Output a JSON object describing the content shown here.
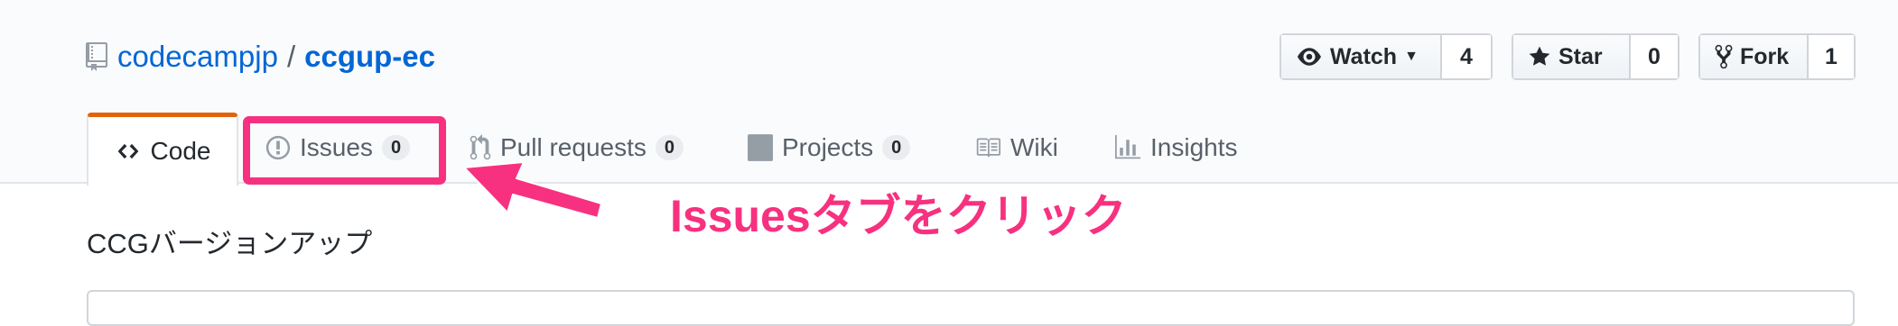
{
  "repo": {
    "owner": "codecampjp",
    "separator": "/",
    "name": "ccgup-ec",
    "description": "CCGバージョンアップ"
  },
  "actions": {
    "watch": {
      "label": "Watch",
      "count": "4",
      "icon": "eye-icon"
    },
    "star": {
      "label": "Star",
      "count": "0",
      "icon": "star-icon"
    },
    "fork": {
      "label": "Fork",
      "count": "1",
      "icon": "repo-forked-icon"
    }
  },
  "tabs": [
    {
      "label": "Code",
      "icon": "code-icon",
      "selected": true
    },
    {
      "label": "Issues",
      "count": "0",
      "icon": "issue-opened-icon"
    },
    {
      "label": "Pull requests",
      "count": "0",
      "icon": "git-pull-request-icon"
    },
    {
      "label": "Projects",
      "count": "0",
      "icon": "project-icon"
    },
    {
      "label": "Wiki",
      "icon": "book-icon"
    },
    {
      "label": "Insights",
      "icon": "graph-icon"
    }
  ],
  "annotation": {
    "text": "Issuesタブをクリック",
    "color": "#f7317f"
  },
  "colors": {
    "link": "#0366d6",
    "selected_tab_accent": "#e36209",
    "annotation": "#f7317f"
  }
}
